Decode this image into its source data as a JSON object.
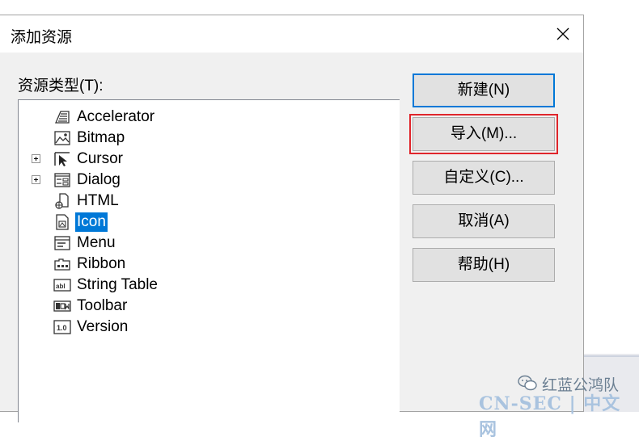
{
  "dialog": {
    "title": "添加资源",
    "resource_type_label": "资源类型(T):",
    "tree_items": [
      {
        "label": "Accelerator",
        "icon": "accelerator-icon",
        "expandable": false,
        "selected": false
      },
      {
        "label": "Bitmap",
        "icon": "bitmap-icon",
        "expandable": false,
        "selected": false
      },
      {
        "label": "Cursor",
        "icon": "cursor-icon",
        "expandable": true,
        "selected": false
      },
      {
        "label": "Dialog",
        "icon": "dialog-icon",
        "expandable": true,
        "selected": false
      },
      {
        "label": "HTML",
        "icon": "html-icon",
        "expandable": false,
        "selected": false
      },
      {
        "label": "Icon",
        "icon": "icon-resource-icon",
        "expandable": false,
        "selected": true
      },
      {
        "label": "Menu",
        "icon": "menu-icon",
        "expandable": false,
        "selected": false
      },
      {
        "label": "Ribbon",
        "icon": "ribbon-icon",
        "expandable": false,
        "selected": false
      },
      {
        "label": "String Table",
        "icon": "string-table-icon",
        "expandable": false,
        "selected": false
      },
      {
        "label": "Toolbar",
        "icon": "toolbar-icon",
        "expandable": false,
        "selected": false
      },
      {
        "label": "Version",
        "icon": "version-icon",
        "expandable": false,
        "selected": false
      }
    ],
    "buttons": {
      "new": "新建(N)",
      "import": "导入(M)...",
      "custom": "自定义(C)...",
      "cancel": "取消(A)",
      "help": "帮助(H)"
    },
    "colors": {
      "selection": "#0078d7",
      "highlight_box": "#e0252b"
    }
  },
  "watermark": {
    "account": "红蓝公鸿队",
    "site": "CN-SEC | 中文网"
  }
}
